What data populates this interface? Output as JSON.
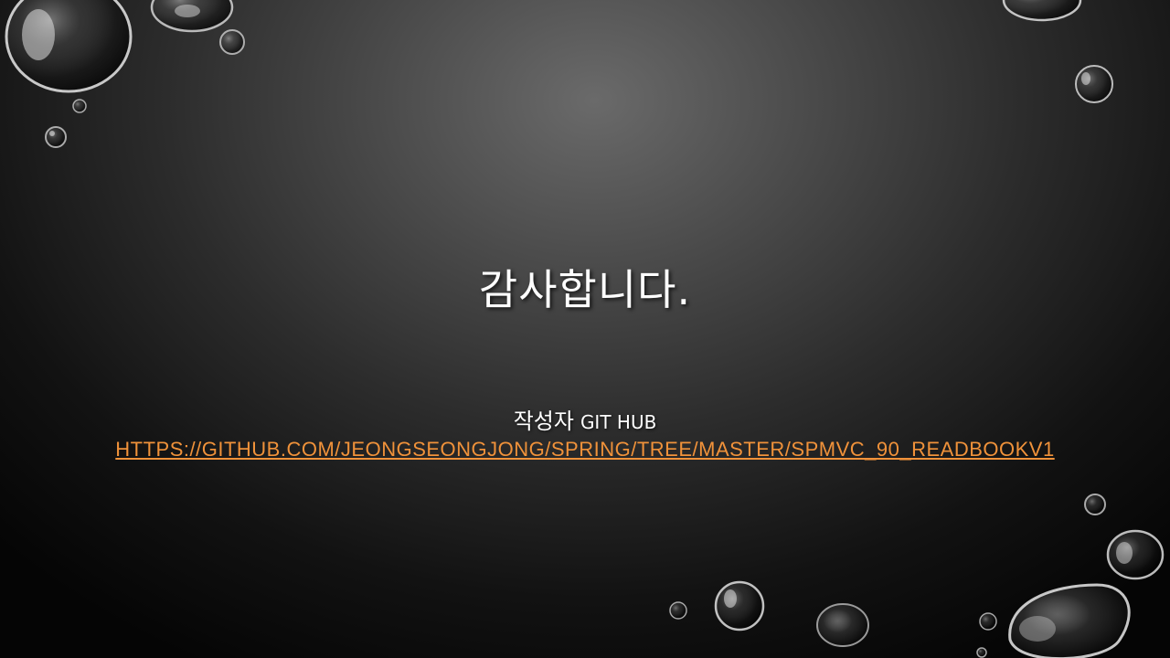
{
  "slide": {
    "title": "감사합니다.",
    "author_label": "작성자",
    "author_suffix": "GIT HUB",
    "link_text": "HTTPS://GITHUB.COM/JEONGSEONGJONG/SPRING/TREE/MASTER/SPMVC_90_READBOOKV1"
  },
  "colors": {
    "background": "#333333",
    "text": "#ffffff",
    "link": "#f0923a"
  }
}
